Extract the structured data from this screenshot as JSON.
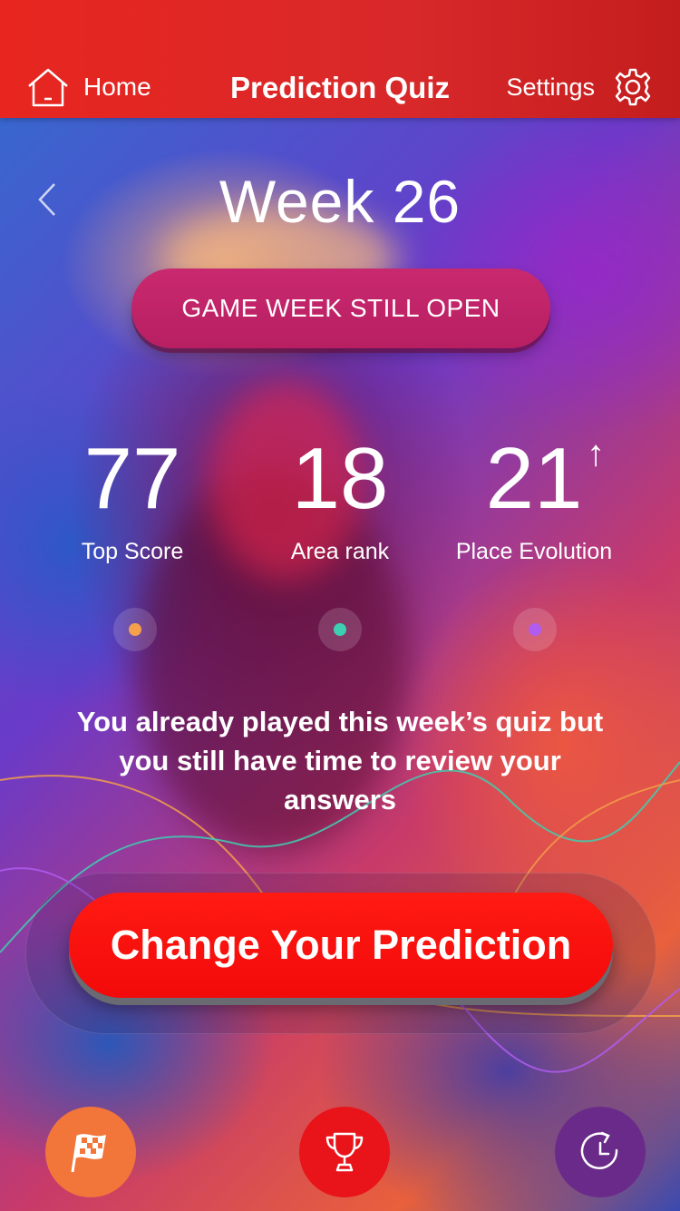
{
  "header": {
    "home_label": "Home",
    "title": "Prediction Quiz",
    "settings_label": "Settings"
  },
  "week": {
    "title": "Week 26",
    "status": "GAME WEEK STILL OPEN"
  },
  "stats": [
    {
      "value": "77",
      "label": "Top Score",
      "dot_color": "#f5a04a"
    },
    {
      "value": "18",
      "label": "Area rank",
      "dot_color": "#3ecfb0"
    },
    {
      "value": "21",
      "label": "Place Evolution",
      "dot_color": "#b05cf0",
      "trend": "↑"
    }
  ],
  "message": "You already played this week’s quiz but you still have time to review your answers",
  "cta": {
    "label": "Change Your Prediction"
  },
  "nav": {
    "flag_icon": "checkered-flag-icon",
    "trophy_icon": "trophy-icon",
    "history_icon": "history-icon"
  },
  "colors": {
    "header": "#e2261f",
    "status_pill": "#c22468",
    "cta": "#f80d0d",
    "nav_flag": "#f2763a",
    "nav_trophy": "#e8141a",
    "nav_history": "#6a2a8a"
  }
}
